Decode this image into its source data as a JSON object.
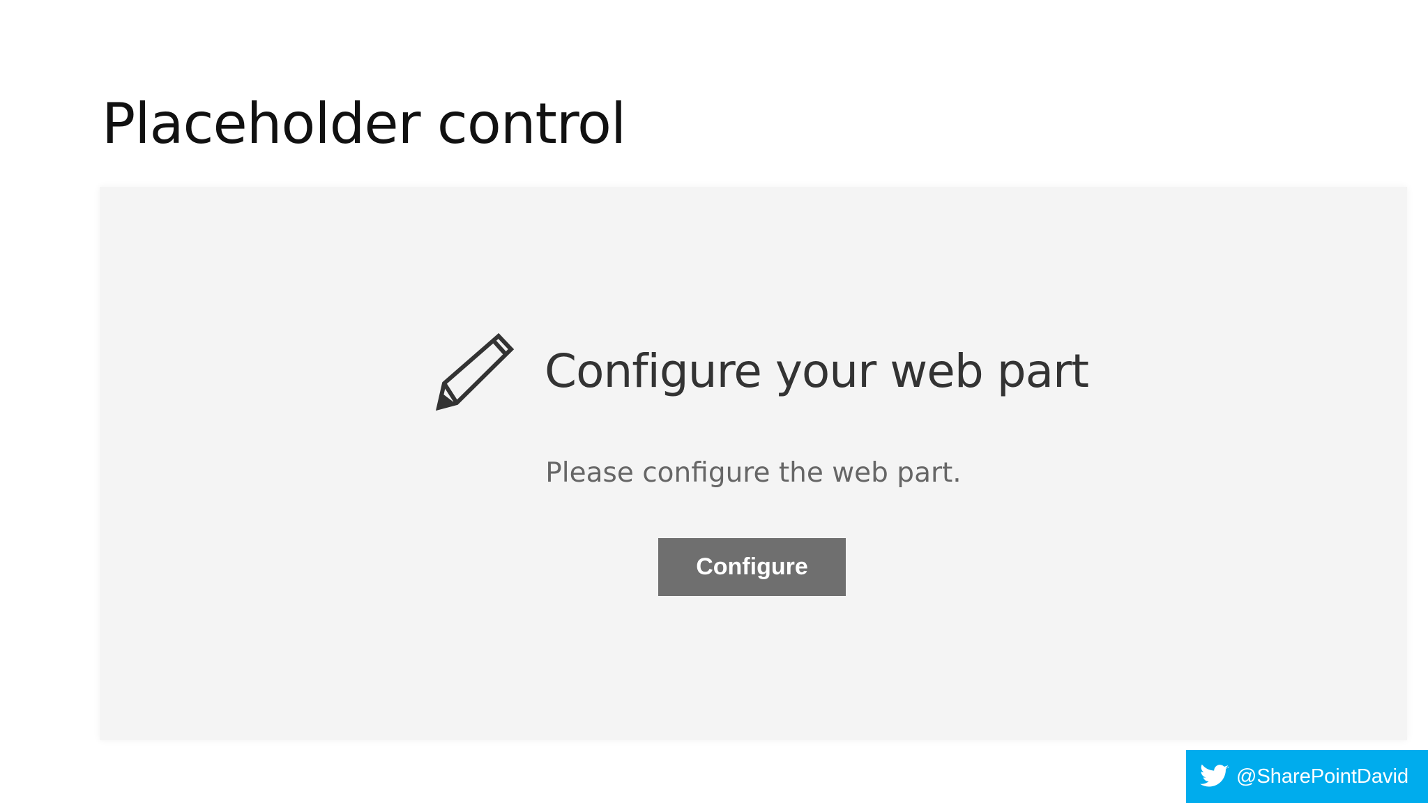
{
  "slide": {
    "title": "Placeholder control"
  },
  "placeholder": {
    "icon": "pencil-icon",
    "title": "Configure your web part",
    "description": "Please configure the web part.",
    "button_label": "Configure"
  },
  "footer": {
    "icon": "twitter-bird-icon",
    "handle": "@SharePointDavid"
  },
  "colors": {
    "panel_background": "#f4f4f4",
    "button_background": "#6f6f6f",
    "twitter_badge": "#00aced",
    "title_text": "#111111"
  }
}
